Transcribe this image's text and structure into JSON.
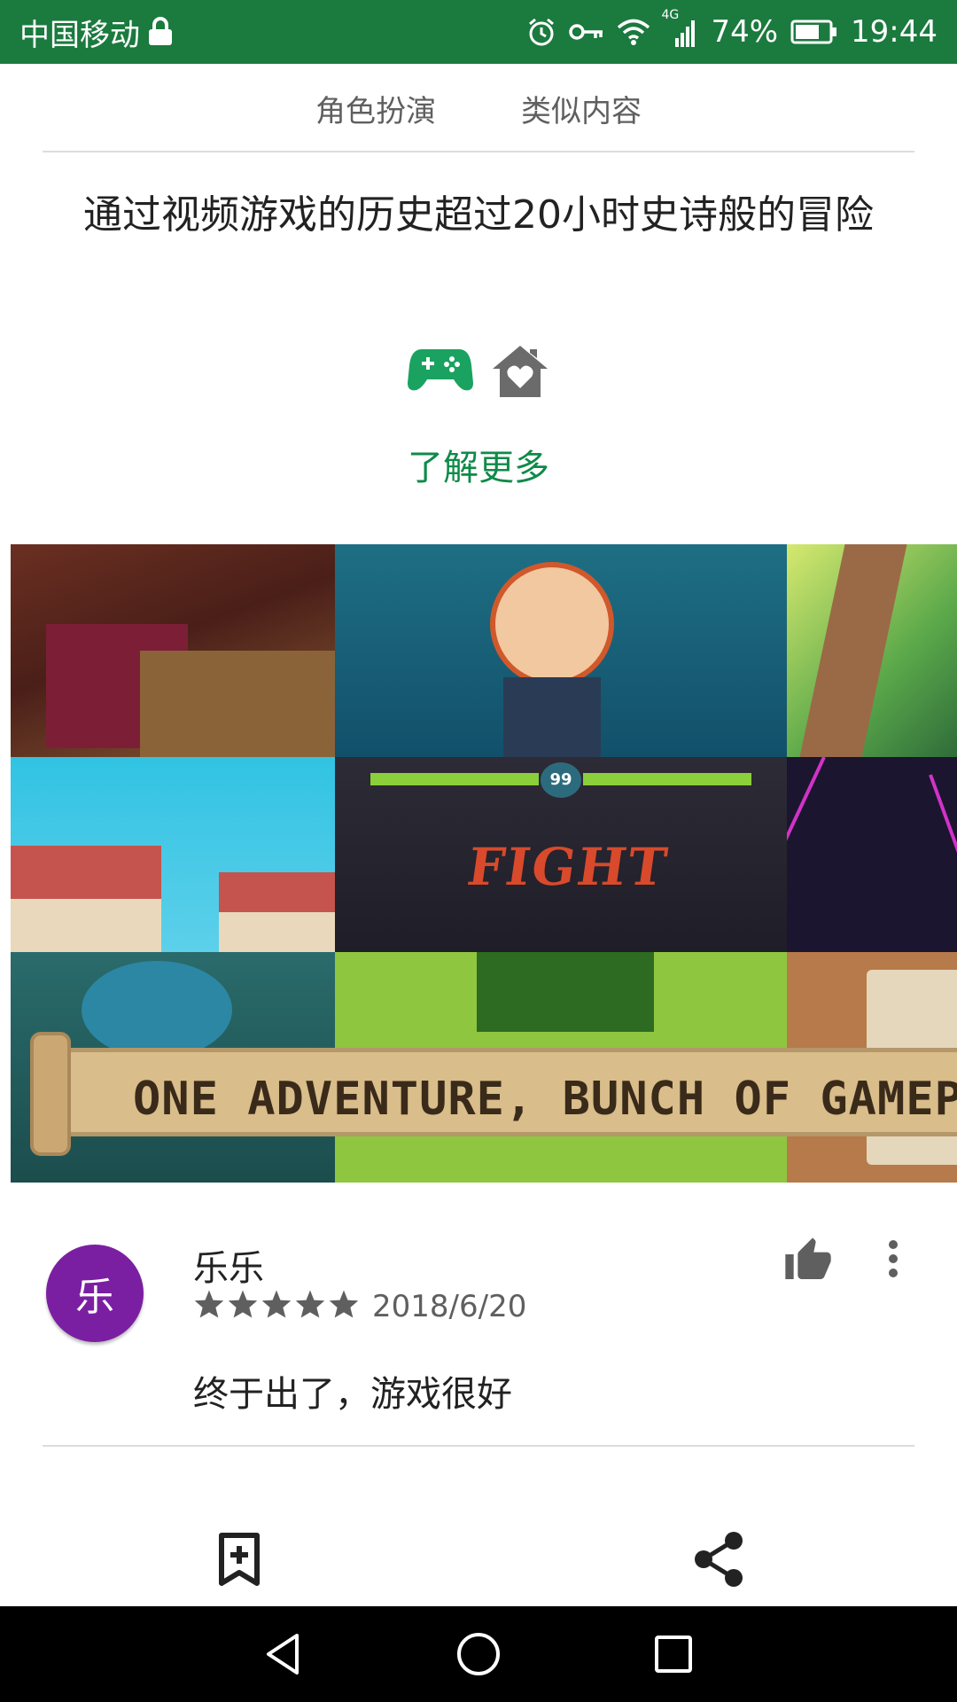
{
  "status_bar": {
    "carrier": "中国移动",
    "battery_percent": "74%",
    "time": "19:44",
    "network": "4G",
    "icons": [
      "lock-icon",
      "alarm-icon",
      "vpn-key-icon",
      "wifi-icon",
      "signal-icon",
      "battery-icon"
    ],
    "background_color": "#1b7a3e"
  },
  "tags": [
    {
      "label": "角色扮演"
    },
    {
      "label": "类似内容"
    }
  ],
  "promo": {
    "text": "通过视频游戏的历史超过20小时史诗般的冒险",
    "badges": [
      "gamepad-icon",
      "family-home-icon"
    ],
    "learn_more": "了解更多",
    "accent_color": "#0f8a4a"
  },
  "feature_graphic": {
    "banner_text": "ONE ADVENTURE, BUNCH OF GAMEPLAY",
    "fight_text": "FIGHT",
    "timer_text": "99"
  },
  "review": {
    "avatar_letter": "乐",
    "avatar_color": "#7b1fa2",
    "author": "乐乐",
    "rating": 5,
    "date": "2018/6/20",
    "text": "终于出了，游戏很好",
    "icons": [
      "thumb-up-icon",
      "more-vert-icon",
      "star-icon"
    ]
  },
  "actions": {
    "icons": [
      "bookmark-add-icon",
      "share-icon"
    ]
  },
  "nav_bar": {
    "icons": [
      "back-icon",
      "home-icon",
      "recents-icon"
    ]
  }
}
